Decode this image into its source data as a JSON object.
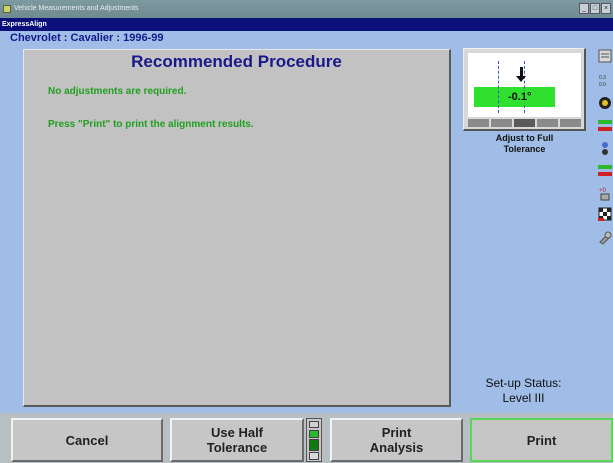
{
  "window": {
    "title": "Vehicle Measurements and Adjustments",
    "subtitle": "ExpressAlign",
    "buttons": [
      "_",
      "□",
      "×"
    ]
  },
  "vehicle": {
    "name": "Chevrolet : Cavalier : 1996-99"
  },
  "main": {
    "heading": "Recommended Procedure",
    "messages": [
      "No adjustments are required.",
      "Press \"Print\" to print the alignment results."
    ]
  },
  "gauge": {
    "value": "-0.1°",
    "caption_line1": "Adjust to Full",
    "caption_line2": "Tolerance",
    "band_color": "#2fe02f"
  },
  "toolbar_icons": [
    "vehicle-info-icon",
    "spec-icon",
    "wheel-icon",
    "camber-icon",
    "tire-icon",
    "caster-icon",
    "toe-icon",
    "print-setup-icon",
    "checkered-flag-icon",
    "wrench-icon"
  ],
  "setup_status": {
    "label": "Set-up Status:",
    "value": "Level III"
  },
  "buttons": {
    "cancel": "Cancel",
    "half_tol_line1": "Use Half",
    "half_tol_line2": "Tolerance",
    "analysis_line1": "Print",
    "analysis_line2": "Analysis",
    "print": "Print"
  },
  "colors": {
    "accent_green": "#20a020",
    "heading_blue": "#19198c",
    "highlight_border": "#58d858",
    "background": "#9fbde6"
  }
}
